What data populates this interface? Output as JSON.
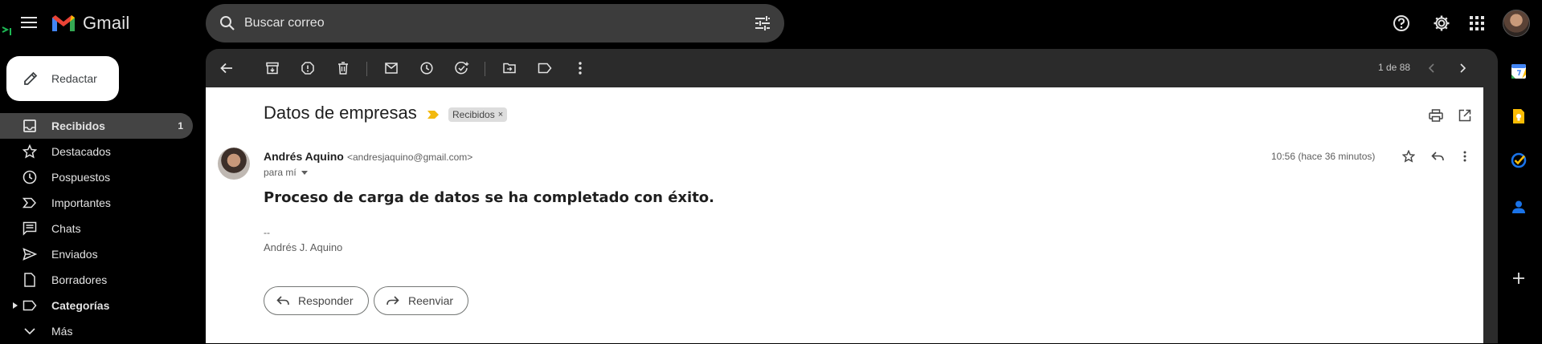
{
  "app": {
    "name": "Gmail"
  },
  "search": {
    "placeholder": "Buscar correo"
  },
  "compose": {
    "label": "Redactar"
  },
  "sidebar": {
    "items": [
      {
        "label": "Recibidos",
        "count": "1",
        "icon": "inbox-icon",
        "active": true
      },
      {
        "label": "Destacados",
        "icon": "star-icon"
      },
      {
        "label": "Pospuestos",
        "icon": "clock-icon"
      },
      {
        "label": "Importantes",
        "icon": "important-icon"
      },
      {
        "label": "Chats",
        "icon": "chat-icon"
      },
      {
        "label": "Enviados",
        "icon": "send-icon"
      },
      {
        "label": "Borradores",
        "icon": "draft-icon"
      },
      {
        "label": "Categorías",
        "icon": "label-icon",
        "bold": true
      },
      {
        "label": "Más",
        "icon": "chevron-down-icon"
      }
    ]
  },
  "toolbar": {
    "pager": "1 de 88"
  },
  "email": {
    "subject": "Datos de empresas",
    "label_chip": "Recibidos",
    "label_close": "×",
    "sender_name": "Andrés Aquino",
    "sender_email": "<andresjaquino@gmail.com>",
    "to": "para mí",
    "time": "10:56 (hace 36 minutos)",
    "body": "Proceso de carga de datos se ha completado con éxito.",
    "signature_dash": "--",
    "signature_name": "Andrés J. Aquino"
  },
  "actions": {
    "reply": "Responder",
    "forward": "Reenviar"
  },
  "colors": {
    "background": "#000000",
    "toolbar": "#2b2b2b",
    "search": "#3c3c3c",
    "active_nav": "#444444",
    "important": "#f2b90f"
  }
}
